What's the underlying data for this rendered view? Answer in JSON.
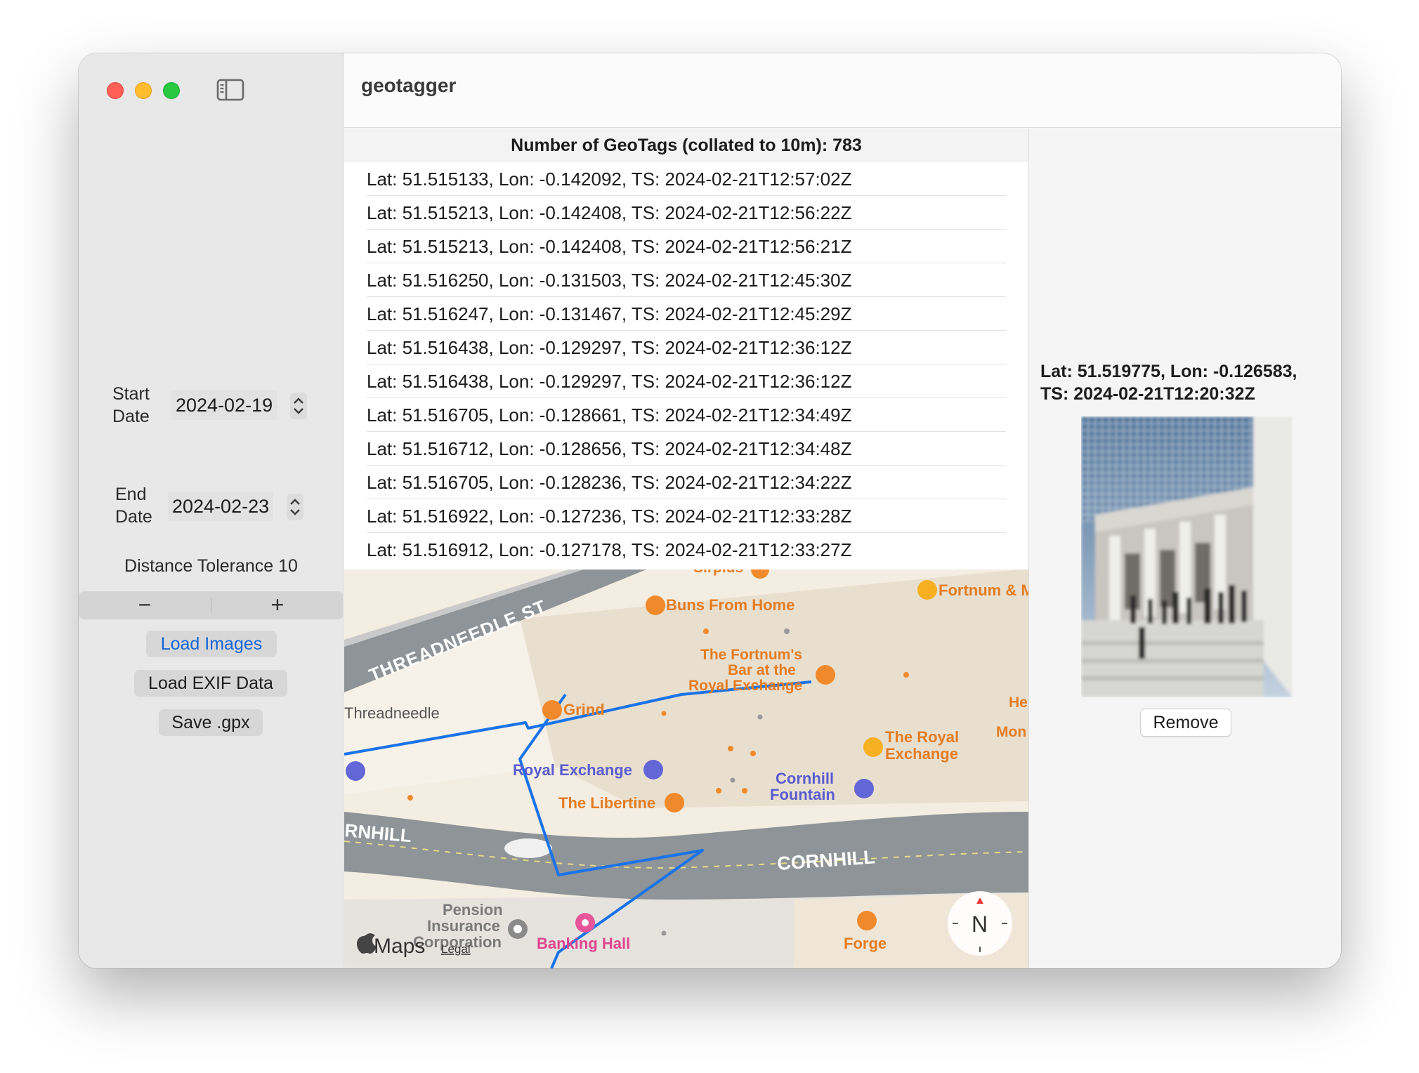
{
  "app": {
    "title": "geotagger"
  },
  "sidebar": {
    "start_date": {
      "label_line1": "Start",
      "label_line2": "Date",
      "value": "2024-02-19"
    },
    "end_date": {
      "label_line1": "End",
      "label_line2": "Date",
      "value": "2024-02-23"
    },
    "distance_tolerance_label": "Distance Tolerance 10",
    "stepper": {
      "minus": "−",
      "plus": "+"
    },
    "buttons": {
      "load_images": "Load Images",
      "load_exif": "Load EXIF Data",
      "save_gpx": "Save .gpx"
    }
  },
  "geotag_list": {
    "header": "Number of GeoTags (collated to 10m): 783",
    "rows": [
      "Lat: 51.515133, Lon: -0.142092, TS: 2024-02-21T12:57:02Z",
      "Lat: 51.515213, Lon: -0.142408, TS: 2024-02-21T12:56:22Z",
      "Lat: 51.515213, Lon: -0.142408, TS: 2024-02-21T12:56:21Z",
      "Lat: 51.516250, Lon: -0.131503, TS: 2024-02-21T12:45:30Z",
      "Lat: 51.516247, Lon: -0.131467, TS: 2024-02-21T12:45:29Z",
      "Lat: 51.516438, Lon: -0.129297, TS: 2024-02-21T12:36:12Z",
      "Lat: 51.516438, Lon: -0.129297, TS: 2024-02-21T12:36:12Z",
      "Lat: 51.516705, Lon: -0.128661, TS: 2024-02-21T12:34:49Z",
      "Lat: 51.516712, Lon: -0.128656, TS: 2024-02-21T12:34:48Z",
      "Lat: 51.516705, Lon: -0.128236, TS: 2024-02-21T12:34:22Z",
      "Lat: 51.516922, Lon: -0.127236, TS: 2024-02-21T12:33:28Z",
      "Lat: 51.516912, Lon: -0.127178, TS: 2024-02-21T12:33:27Z"
    ]
  },
  "map": {
    "streets": {
      "threadneedle": "THREADNEEDLE ST",
      "threadneedle_small": "Threadneedle",
      "cornhill": "CORNHILL",
      "cornhill_left": "RNHILL"
    },
    "pois": {
      "buns": "Buns From Home",
      "fortnum": "Fortnum & M",
      "fortnums_bar_1": "The Fortnum's",
      "fortnums_bar_2": "Bar at the",
      "fortnums_bar_3": "Royal Exchange",
      "grind": "Grind",
      "royal_exchange": "Royal Exchange",
      "royal_exchange_2_1": "The Royal",
      "royal_exchange_2_2": "Exchange",
      "cornhill_fountain_1": "Cornhill",
      "cornhill_fountain_2": "Fountain",
      "libertine": "The Libertine",
      "pension_1": "Pension",
      "pension_2": "Insurance",
      "pension_3": "Corporation",
      "banking_hall": "Banking Hall",
      "forge": "Forge",
      "he": "He",
      "mon": "Mon",
      "sirplus": "Sirplus"
    },
    "attribution": {
      "brand": "Maps",
      "legal": "Legal"
    },
    "compass": "N",
    "colors": {
      "route": "#1a73e8",
      "poi_orange": "#f08a2c",
      "poi_purple": "#6366d6",
      "poi_pink": "#e8569a",
      "road": "#8e9497"
    }
  },
  "detail": {
    "coords_line1": "Lat: 51.519775, Lon: -0.126583,",
    "coords_line2": "TS: 2024-02-21T12:20:32Z",
    "remove_button": "Remove"
  }
}
